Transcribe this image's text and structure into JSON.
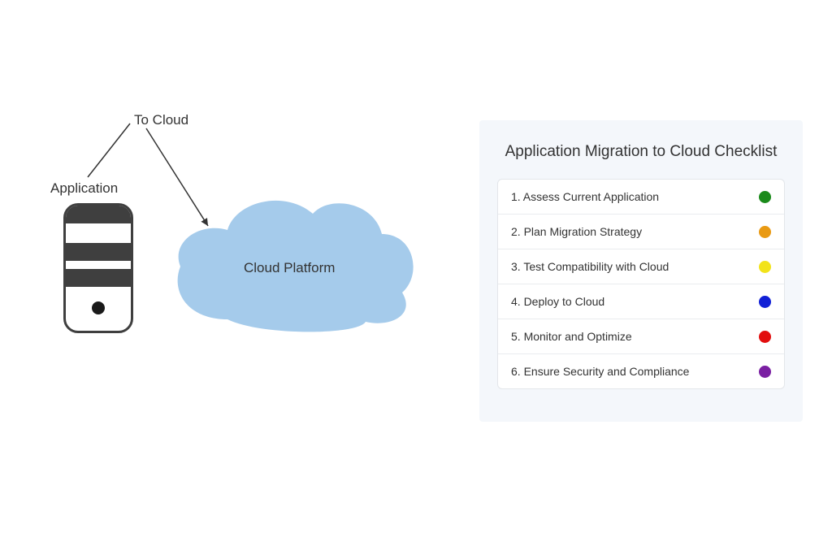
{
  "diagram": {
    "application_label": "Application",
    "to_cloud_label": "To Cloud",
    "cloud_platform_label": "Cloud Platform",
    "cloud_fill": "#a5cbeb"
  },
  "checklist": {
    "title": "Application Migration to Cloud Checklist",
    "items": [
      {
        "label": "1. Assess Current Application",
        "color": "#1a8a1a"
      },
      {
        "label": "2. Plan Migration Strategy",
        "color": "#e99a13"
      },
      {
        "label": "3. Test Compatibility with Cloud",
        "color": "#f2e31a"
      },
      {
        "label": "4. Deploy to Cloud",
        "color": "#1120d6"
      },
      {
        "label": "5. Monitor and Optimize",
        "color": "#e20e0e"
      },
      {
        "label": "6. Ensure Security and Compliance",
        "color": "#7a1fa2"
      }
    ]
  }
}
